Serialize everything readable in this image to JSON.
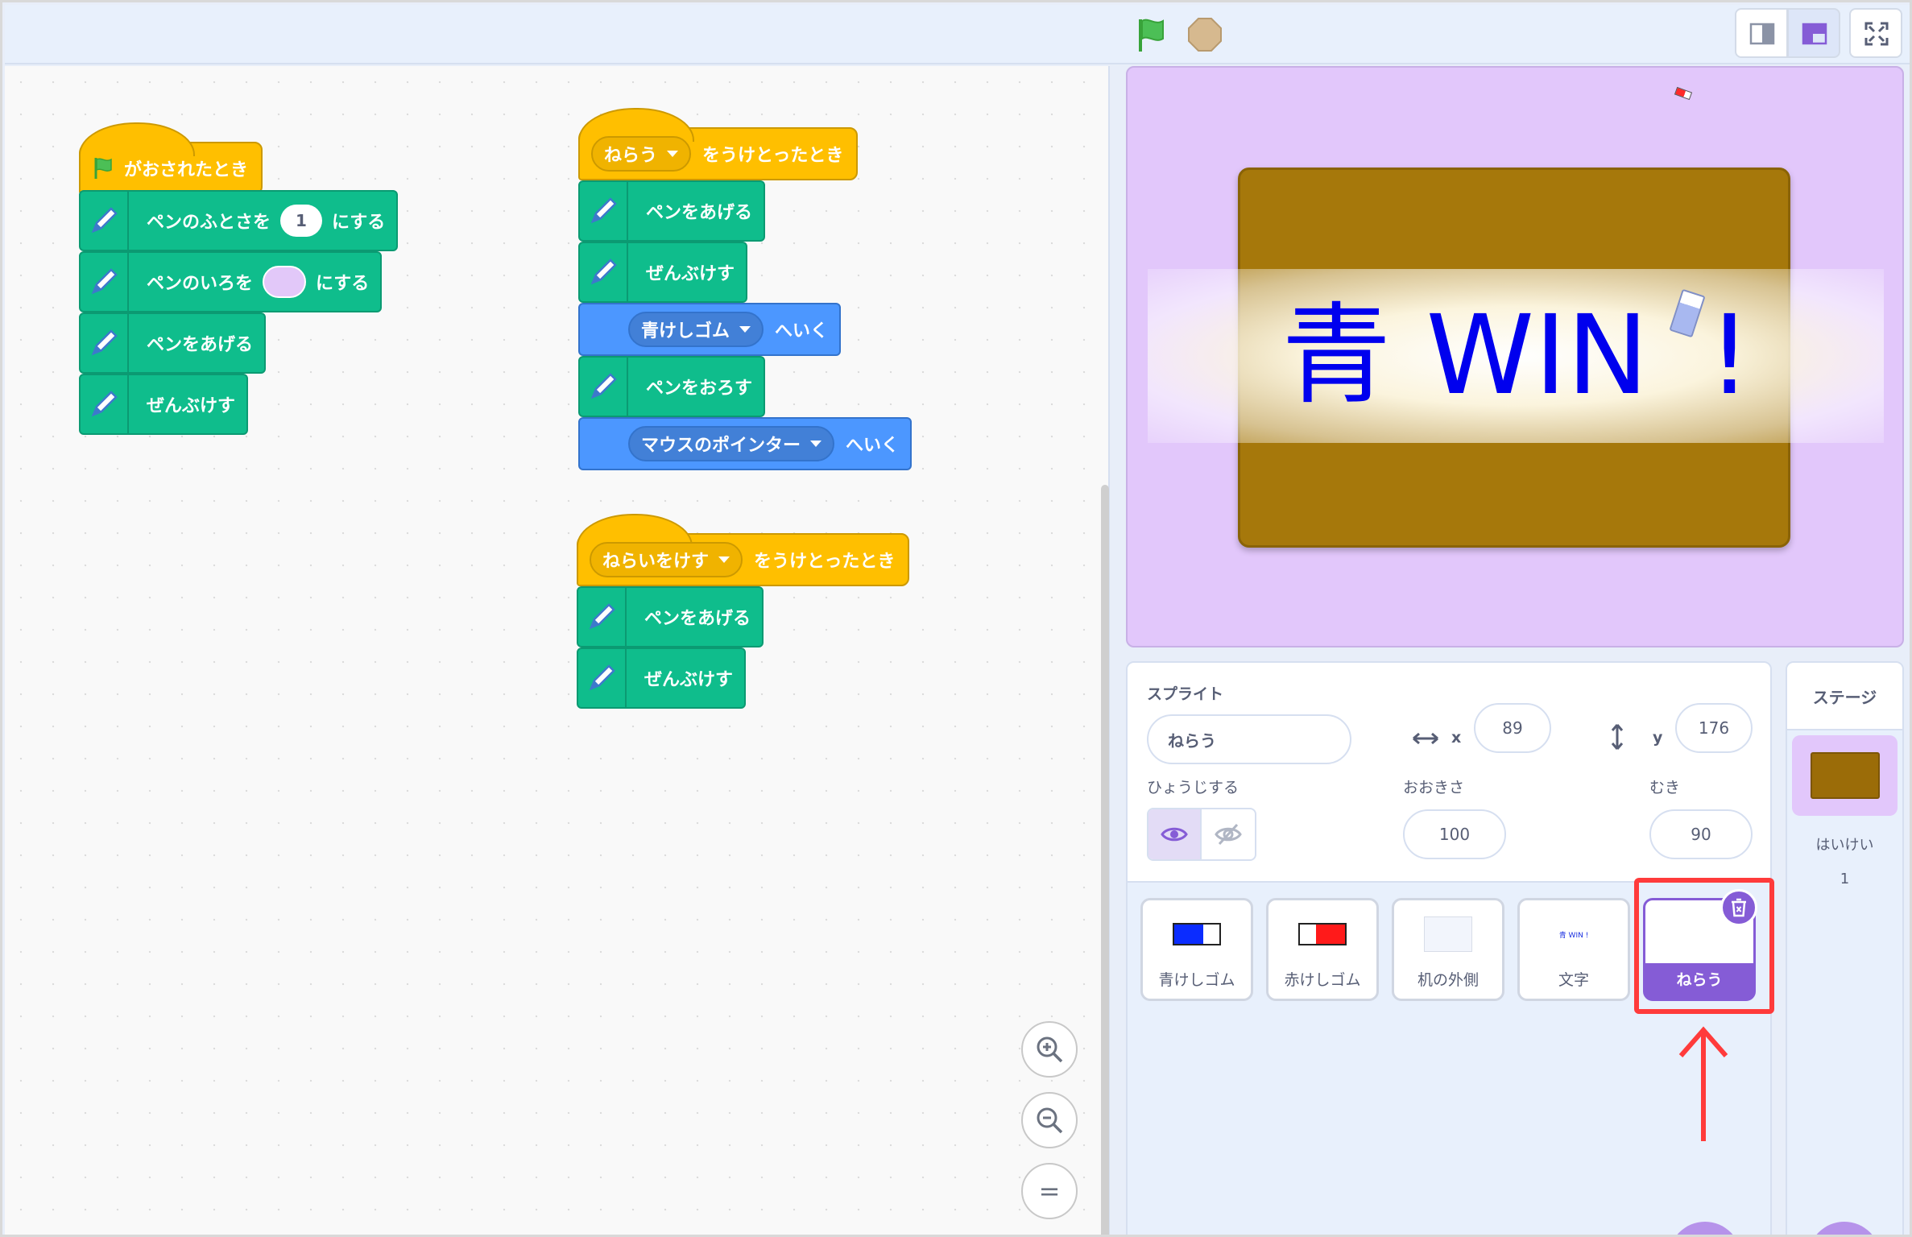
{
  "topbar": {
    "flag_icon": "green-flag-icon",
    "stop_icon": "stop-icon",
    "modes": [
      "small-stage-icon",
      "normal-stage-icon",
      "fullscreen-icon"
    ]
  },
  "scripts": {
    "script1": {
      "hat": "がおされたとき",
      "blocks": [
        {
          "pre": "ペンのふとさを",
          "value": "1",
          "post": "にする"
        },
        {
          "pre": "ペンのいろを",
          "post": "にする"
        },
        {
          "text": "ペンをあげる"
        },
        {
          "text": "ぜんぶけす"
        }
      ]
    },
    "script2": {
      "hat_dropdown": "ねらう",
      "hat_text": "をうけとったとき",
      "blocks": [
        {
          "text": "ペンをあげる"
        },
        {
          "text": "ぜんぶけす"
        },
        {
          "dropdown": "青けしゴム",
          "text": "へいく"
        },
        {
          "text": "ペンをおろす"
        },
        {
          "dropdown": "マウスのポインター",
          "text": "へいく"
        }
      ]
    },
    "script3": {
      "hat_dropdown": "ねらいをけす",
      "hat_text": "をうけとったとき",
      "blocks": [
        {
          "text": "ペンをあげる"
        },
        {
          "text": "ぜんぶけす"
        }
      ]
    }
  },
  "zoom": {
    "in": "+",
    "out": "−",
    "reset": "="
  },
  "stage": {
    "text_blue": "青",
    "text_win": "WIN",
    "text_excl": "!"
  },
  "sprite_info": {
    "sprite_label": "スプライト",
    "name": "ねらう",
    "x_label": "x",
    "x_value": "89",
    "y_label": "y",
    "y_value": "176",
    "show_label": "ひょうじする",
    "size_label": "おおきさ",
    "size_value": "100",
    "direction_label": "むき",
    "direction_value": "90"
  },
  "sprites": [
    {
      "name": "青けしゴム",
      "color": "#0b2cff"
    },
    {
      "name": "赤けしゴム",
      "color": "#ff1a1a"
    },
    {
      "name": "机の外側"
    },
    {
      "name": "文字",
      "thumb_text": "青 WIN !"
    },
    {
      "name": "ねらう",
      "selected": true
    }
  ],
  "stage_panel": {
    "title": "ステージ",
    "backdrops_label": "はいけい",
    "backdrops_count": "1"
  },
  "colors": {
    "events": "#ffbf00",
    "pen": "#0fbd8c",
    "motion": "#4c97ff",
    "accent": "#855cd6",
    "highlight": "#ff3b3b"
  }
}
